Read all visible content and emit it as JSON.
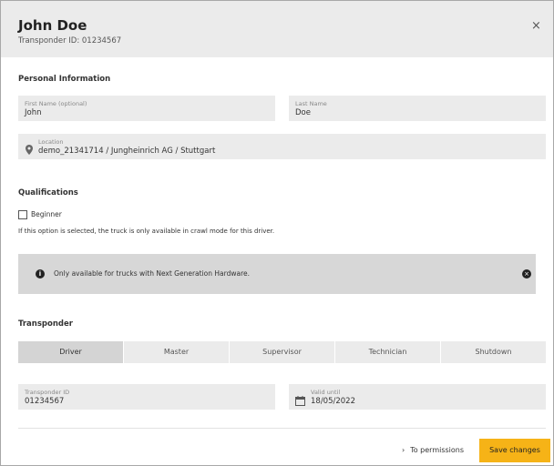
{
  "header": {
    "title": "John Doe",
    "subtitle": "Transponder ID: 01234567",
    "close_icon": "×"
  },
  "personal": {
    "section_title": "Personal Information",
    "first_name": {
      "label": "First Name (optional)",
      "value": "John"
    },
    "last_name": {
      "label": "Last Name",
      "value": "Doe"
    },
    "location": {
      "label": "Location",
      "value": "demo_21341714 / Jungheinrich AG / Stuttgart",
      "icon": "location-pin-icon"
    }
  },
  "qualifications": {
    "section_title": "Qualifications",
    "beginner_label": "Beginner",
    "beginner_checked": false,
    "beginner_hint": "If this option is selected, the truck is only available in crawl mode for this driver."
  },
  "banner": {
    "text": "Only available for trucks with Next Generation Hardware.",
    "info_icon": "i",
    "close_icon": "×"
  },
  "transponder": {
    "section_title": "Transponder",
    "tabs": [
      "Driver",
      "Master",
      "Supervisor",
      "Technician",
      "Shutdown"
    ],
    "active_tab": "Driver",
    "id_field": {
      "label": "Transponder ID",
      "value": "01234567"
    },
    "valid_until": {
      "label": "Valid until",
      "value": "18/05/2022",
      "icon": "calendar-icon"
    }
  },
  "footer": {
    "permissions_link": "To permissions",
    "permissions_icon": "chevron-right-icon",
    "save_label": "Save changes"
  },
  "colors": {
    "accent": "#f6b317",
    "field_bg": "#ebebeb",
    "banner_bg": "#d7d7d7"
  }
}
